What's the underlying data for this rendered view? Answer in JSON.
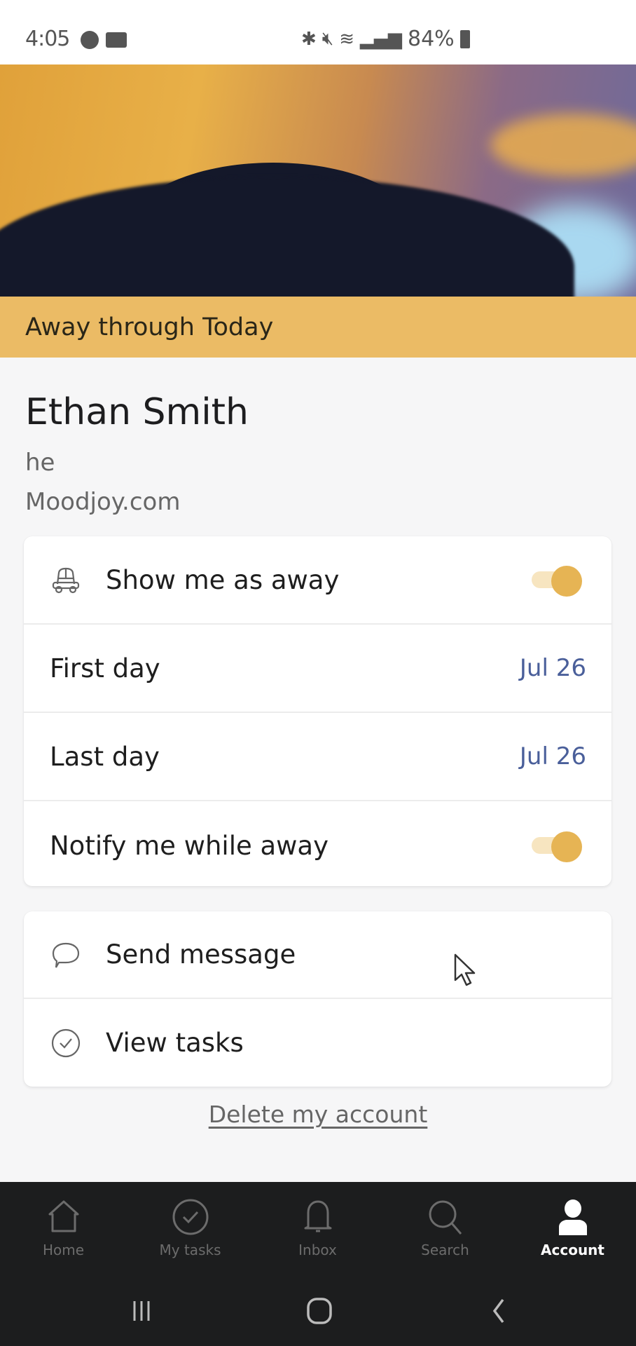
{
  "status_bar": {
    "time": "4:05",
    "left_icons": [
      "messenger-icon",
      "video-camera-icon"
    ],
    "right_icons": [
      "bluetooth-icon",
      "mute-icon",
      "wifi-icon",
      "signal-icon"
    ],
    "battery": "84%"
  },
  "hero": {
    "image": "sunset-tree-cover-photo"
  },
  "away_banner": {
    "text": "Away through Today",
    "color": "#EBBB65"
  },
  "profile": {
    "name": "Ethan Smith",
    "pronoun": "he",
    "organization": "Moodjoy.com"
  },
  "away_settings": [
    {
      "label": "Show me as away",
      "icon": "car-icon",
      "type": "toggle",
      "on": true
    },
    {
      "label": "First day",
      "type": "value",
      "value": "Jul 26"
    },
    {
      "label": "Last day",
      "type": "value",
      "value": "Jul 26"
    },
    {
      "label": "Notify me while away",
      "type": "toggle",
      "on": true
    }
  ],
  "actions": [
    {
      "label": "Send message",
      "icon": "chat-bubble-icon"
    },
    {
      "label": "View tasks",
      "icon": "check-circle-icon"
    }
  ],
  "delete_link": "Delete my account",
  "bottom_nav": [
    {
      "label": "Home",
      "icon": "home-icon",
      "active": false
    },
    {
      "label": "My tasks",
      "icon": "check-circle-icon",
      "active": false
    },
    {
      "label": "Inbox",
      "icon": "bell-icon",
      "active": false
    },
    {
      "label": "Search",
      "icon": "search-icon",
      "active": false
    },
    {
      "label": "Account",
      "icon": "person-icon",
      "active": true
    }
  ],
  "system_nav": [
    "recent-apps",
    "home",
    "back"
  ],
  "colors": {
    "accent": "#E6B454",
    "date_value": "#4A5F9A",
    "nav_bg": "#1C1D1E"
  }
}
